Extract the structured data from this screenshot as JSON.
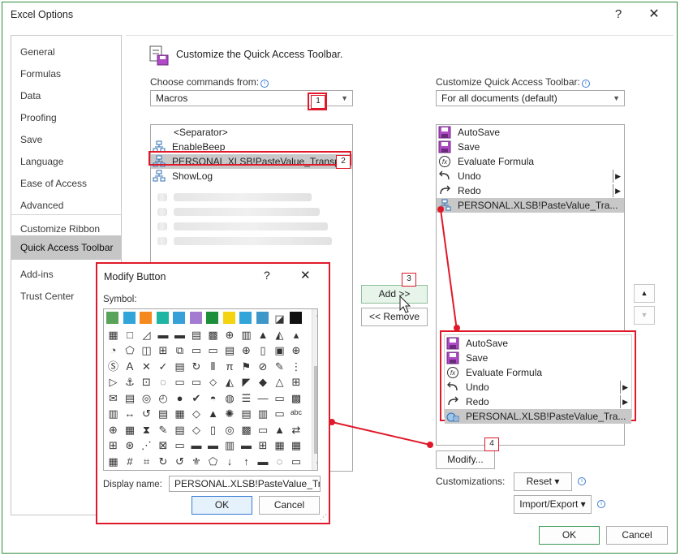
{
  "window": {
    "title": "Excel Options",
    "help": "?",
    "close": "✕"
  },
  "nav": [
    {
      "label": "General"
    },
    {
      "label": "Formulas"
    },
    {
      "label": "Data"
    },
    {
      "label": "Proofing"
    },
    {
      "label": "Save"
    },
    {
      "label": "Language"
    },
    {
      "label": "Ease of Access"
    },
    {
      "label": "Advanced"
    },
    {
      "label": "Customize Ribbon"
    },
    {
      "label": "Quick Access Toolbar"
    },
    {
      "label": "Add-ins"
    },
    {
      "label": "Trust Center"
    }
  ],
  "nav_active": "Quick Access Toolbar",
  "header": {
    "text": "Customize the Quick Access Toolbar."
  },
  "left": {
    "label": "Choose commands from:",
    "value": "Macros",
    "items": [
      {
        "text": "<Separator>",
        "icon": "none"
      },
      {
        "text": "EnableBeep",
        "icon": "macro-icon"
      },
      {
        "text": "PERSONAL.XLSB!PasteValue_Transp",
        "icon": "macro-icon",
        "selected": true
      },
      {
        "text": "ShowLog",
        "icon": "macro-icon"
      }
    ]
  },
  "right": {
    "label": "Customize Quick Access Toolbar:",
    "value": "For all documents (default)",
    "items": [
      {
        "text": "AutoSave",
        "icon": "save-icon"
      },
      {
        "text": "Save",
        "icon": "save-icon"
      },
      {
        "text": "Evaluate Formula",
        "icon": "fx-icon"
      },
      {
        "text": "Undo",
        "icon": "undo-icon",
        "submenu": true
      },
      {
        "text": "Redo",
        "icon": "redo-icon",
        "submenu": true
      },
      {
        "text": "PERSONAL.XLSB!PasteValue_Tra...",
        "icon": "macro-icon",
        "selected": true
      }
    ]
  },
  "zoom_items": [
    {
      "text": "AutoSave",
      "icon": "save-icon"
    },
    {
      "text": "Save",
      "icon": "save-icon"
    },
    {
      "text": "Evaluate Formula",
      "icon": "fx-icon"
    },
    {
      "text": "Undo",
      "icon": "undo-icon",
      "submenu": true
    },
    {
      "text": "Redo",
      "icon": "redo-icon",
      "submenu": true
    },
    {
      "text": "PERSONAL.XLSB!PasteValue_Tra...",
      "icon": "paste-value-icon",
      "selected": true
    }
  ],
  "buttons": {
    "add": "Add >>",
    "remove": "<< Remove",
    "modify": "Modify...",
    "customizations": "Customizations:",
    "reset": "Reset ▾",
    "import_export": "Import/Export ▾",
    "ok": "OK",
    "cancel": "Cancel",
    "move_up": "▲",
    "move_down": "▼"
  },
  "badges": [
    "1",
    "2",
    "3",
    "4"
  ],
  "modify_dialog": {
    "title": "Modify Button",
    "help": "?",
    "close": "✕",
    "symbol_label": "Symbol:",
    "display_name_label": "Display name:",
    "display_name_value": "PERSONAL.XLSB!PasteValue_Transpo",
    "ok": "OK",
    "cancel": "Cancel"
  },
  "colors": {
    "accent_red": "#e0192a",
    "window_border": "#2e8b3c",
    "nav_selected": "#c6c6c6"
  }
}
